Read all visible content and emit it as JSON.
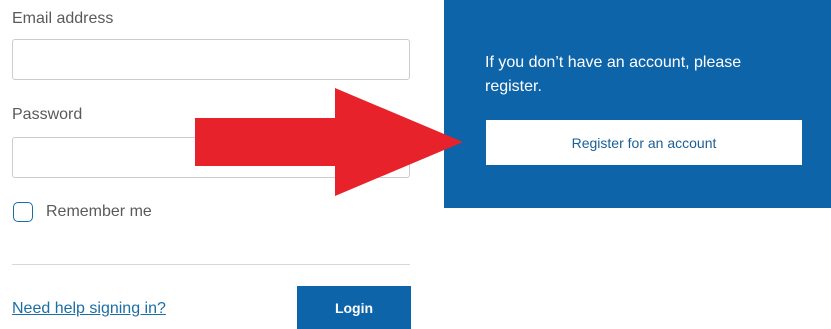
{
  "login_form": {
    "email_label": "Email address",
    "email_value": "",
    "password_label": "Password",
    "password_value": "",
    "remember_label": "Remember me",
    "help_link": "Need help signing in?",
    "login_button": "Login"
  },
  "register": {
    "message": "If you don’t have an account, please register.",
    "button": "Register for an account"
  },
  "annotation": {
    "arrow_color": "#e8222a"
  },
  "colors": {
    "brand_blue": "#0e64a8",
    "link_blue": "#1a6ea6"
  }
}
